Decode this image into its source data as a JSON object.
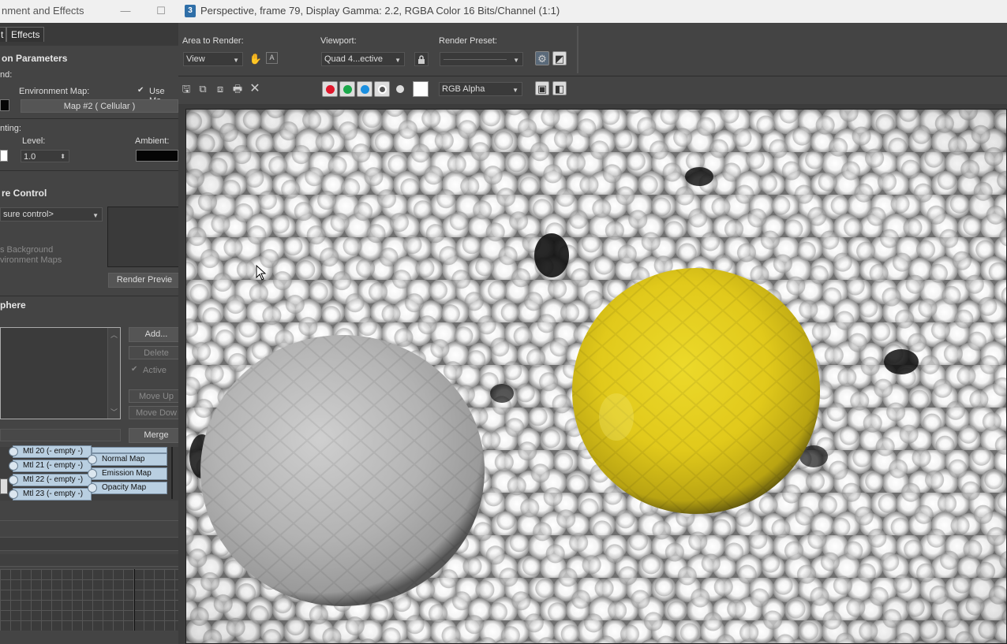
{
  "env_window": {
    "title": "nment and Effects",
    "tabs": [
      "t",
      "Effects"
    ],
    "common_params_header": "on Parameters",
    "background_label": "nd:",
    "environment_map_label": "Environment Map:",
    "use_map_label": "Use Ma",
    "map_button": "Map #2  ( Cellular )",
    "lighting_label": "nting:",
    "level_label": "Level:",
    "level_value": "1.0",
    "ambient_label": "Ambient:",
    "exposure_header": "re Control",
    "exposure_combo": "sure control>",
    "process_bg_label": "s Background",
    "env_maps_label": "vironment Maps",
    "render_preview": "Render Previe",
    "atmosphere_header": "phere",
    "add": "Add...",
    "delete": "Delete",
    "active": "Active",
    "move_up": "Move Up",
    "move_down": "Move Dow",
    "merge": "Merge",
    "slate": {
      "materials": [
        "Mtl 20 (- empty -)",
        "Mtl 21 (- empty -)",
        "Mtl 22 (- empty -)",
        "Mtl 23 (- empty -)"
      ],
      "maps": [
        "Normal Map",
        "Emission Map",
        "Opacity Map"
      ]
    }
  },
  "render_window": {
    "icon_label": "3",
    "title": "Perspective, frame 79, Display Gamma: 2.2, RGBA Color 16 Bits/Channel (1:1)",
    "area_to_render_label": "Area to Render:",
    "area_to_render_value": "View",
    "viewport_label": "Viewport:",
    "viewport_value": "Quad 4...ective",
    "render_preset_label": "Render Preset:",
    "render_preset_value": "",
    "channel_value": "RGB Alpha",
    "channel_colors": {
      "red": "#e0162b",
      "green": "#1aa84a",
      "blue": "#1a8fe0"
    }
  }
}
